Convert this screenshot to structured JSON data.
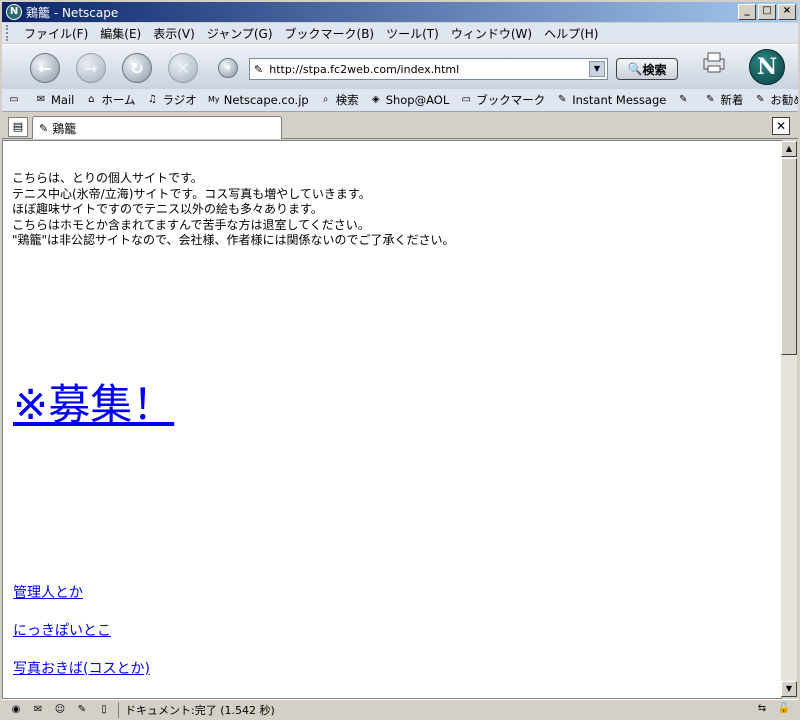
{
  "window": {
    "title": "鶏籠 - Netscape"
  },
  "menu": [
    "ファイル(F)",
    "編集(E)",
    "表示(V)",
    "ジャンプ(G)",
    "ブックマーク(B)",
    "ツール(T)",
    "ウィンドウ(W)",
    "ヘルプ(H)"
  ],
  "nav": {
    "url": "http://stpa.fc2web.com/index.html",
    "search_label": "検索",
    "logo_letter": "N"
  },
  "personal_toolbar": [
    "Mail",
    "ホーム",
    "ラジオ",
    "Netscape.co.jp",
    "検索",
    "Shop@AOL",
    "ブックマーク",
    "Instant Message",
    "新着",
    "お勧め"
  ],
  "tab": {
    "label": "鶏籠"
  },
  "page": {
    "intro": [
      "こちらは、とりの個人サイトです。",
      "テニス中心(氷帝/立海)サイトです。コス写真も増やしていきます。",
      "ほぼ趣味サイトですのでテニス以外の絵も多々あります。",
      "こちらはホモとか含まれてますんで苦手な方は退室してください。",
      "\"鶏籠\"は非公認サイトなので、会社様、作者様には関係ないのでご了承ください。"
    ],
    "recruit_link": "※募集！",
    "links": [
      "管理人とか",
      "にっきぽいとこ",
      "写真おきば(コスとか)"
    ]
  },
  "status": {
    "text": "ドキュメント:完了 (1.542 秒)"
  }
}
